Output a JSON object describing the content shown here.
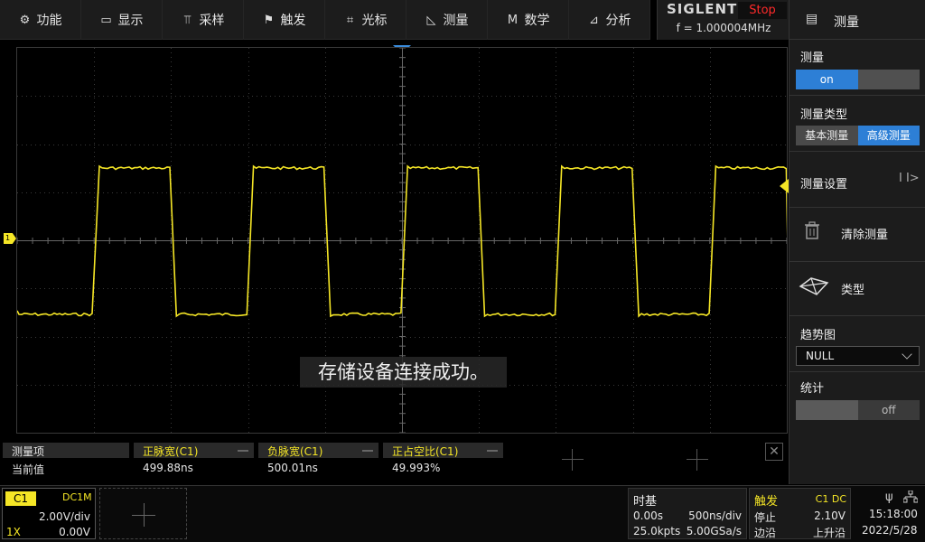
{
  "menu": {
    "items": [
      {
        "label": "功能",
        "icon": "gear-icon"
      },
      {
        "label": "显示",
        "icon": "monitor-icon"
      },
      {
        "label": "采样",
        "icon": "acquire-icon"
      },
      {
        "label": "触发",
        "icon": "flag-icon"
      },
      {
        "label": "光标",
        "icon": "cursor-icon"
      },
      {
        "label": "测量",
        "icon": "measure-icon"
      },
      {
        "label": "数学",
        "icon": "math-icon"
      },
      {
        "label": "分析",
        "icon": "analyze-icon"
      }
    ]
  },
  "brand": {
    "name": "SIGLENT",
    "run_status": "Stop",
    "frequency": "f = 1.000004MHz"
  },
  "screen": {
    "toast": "存储设备连接成功。",
    "channel_marker": "1"
  },
  "panel": {
    "header": "测量",
    "measure": {
      "title": "测量",
      "on_label": "on",
      "state": "on"
    },
    "measure_type": {
      "title": "测量类型",
      "basic": "基本测量",
      "advanced": "高级测量",
      "selected": "高级测量"
    },
    "settings": {
      "label": "测量设置",
      "arrow": "I I>"
    },
    "clear": {
      "label": "清除测量"
    },
    "type": {
      "label": "类型"
    },
    "trend": {
      "title": "趋势图",
      "value": "NULL"
    },
    "stats": {
      "title": "统计",
      "off_label": "off",
      "state": "off"
    }
  },
  "measurements": {
    "label_header": "测量项",
    "label_value": "当前值",
    "items": [
      {
        "name": "正脉宽(C1)",
        "value": "499.88ns"
      },
      {
        "name": "负脉宽(C1)",
        "value": "500.01ns"
      },
      {
        "name": "正占空比(C1)",
        "value": "49.993%"
      }
    ],
    "close": "✕"
  },
  "channel1": {
    "tag": "C1",
    "coupling": "DC1M",
    "scale": "2.00V/div",
    "probe": "1X",
    "offset": "0.00V",
    "color": "#f5e626"
  },
  "timebase": {
    "title": "时基",
    "delay": "0.00s",
    "scale": "500ns/div",
    "memory": "25.0kpts",
    "sample_rate": "5.00GSa/s"
  },
  "trigger": {
    "title": "触发",
    "source": "C1 DC",
    "mode": "停止",
    "level": "2.10V",
    "type": "边沿",
    "slope": "上升沿"
  },
  "status": {
    "time": "15:18:00",
    "date": "2022/5/28"
  }
}
